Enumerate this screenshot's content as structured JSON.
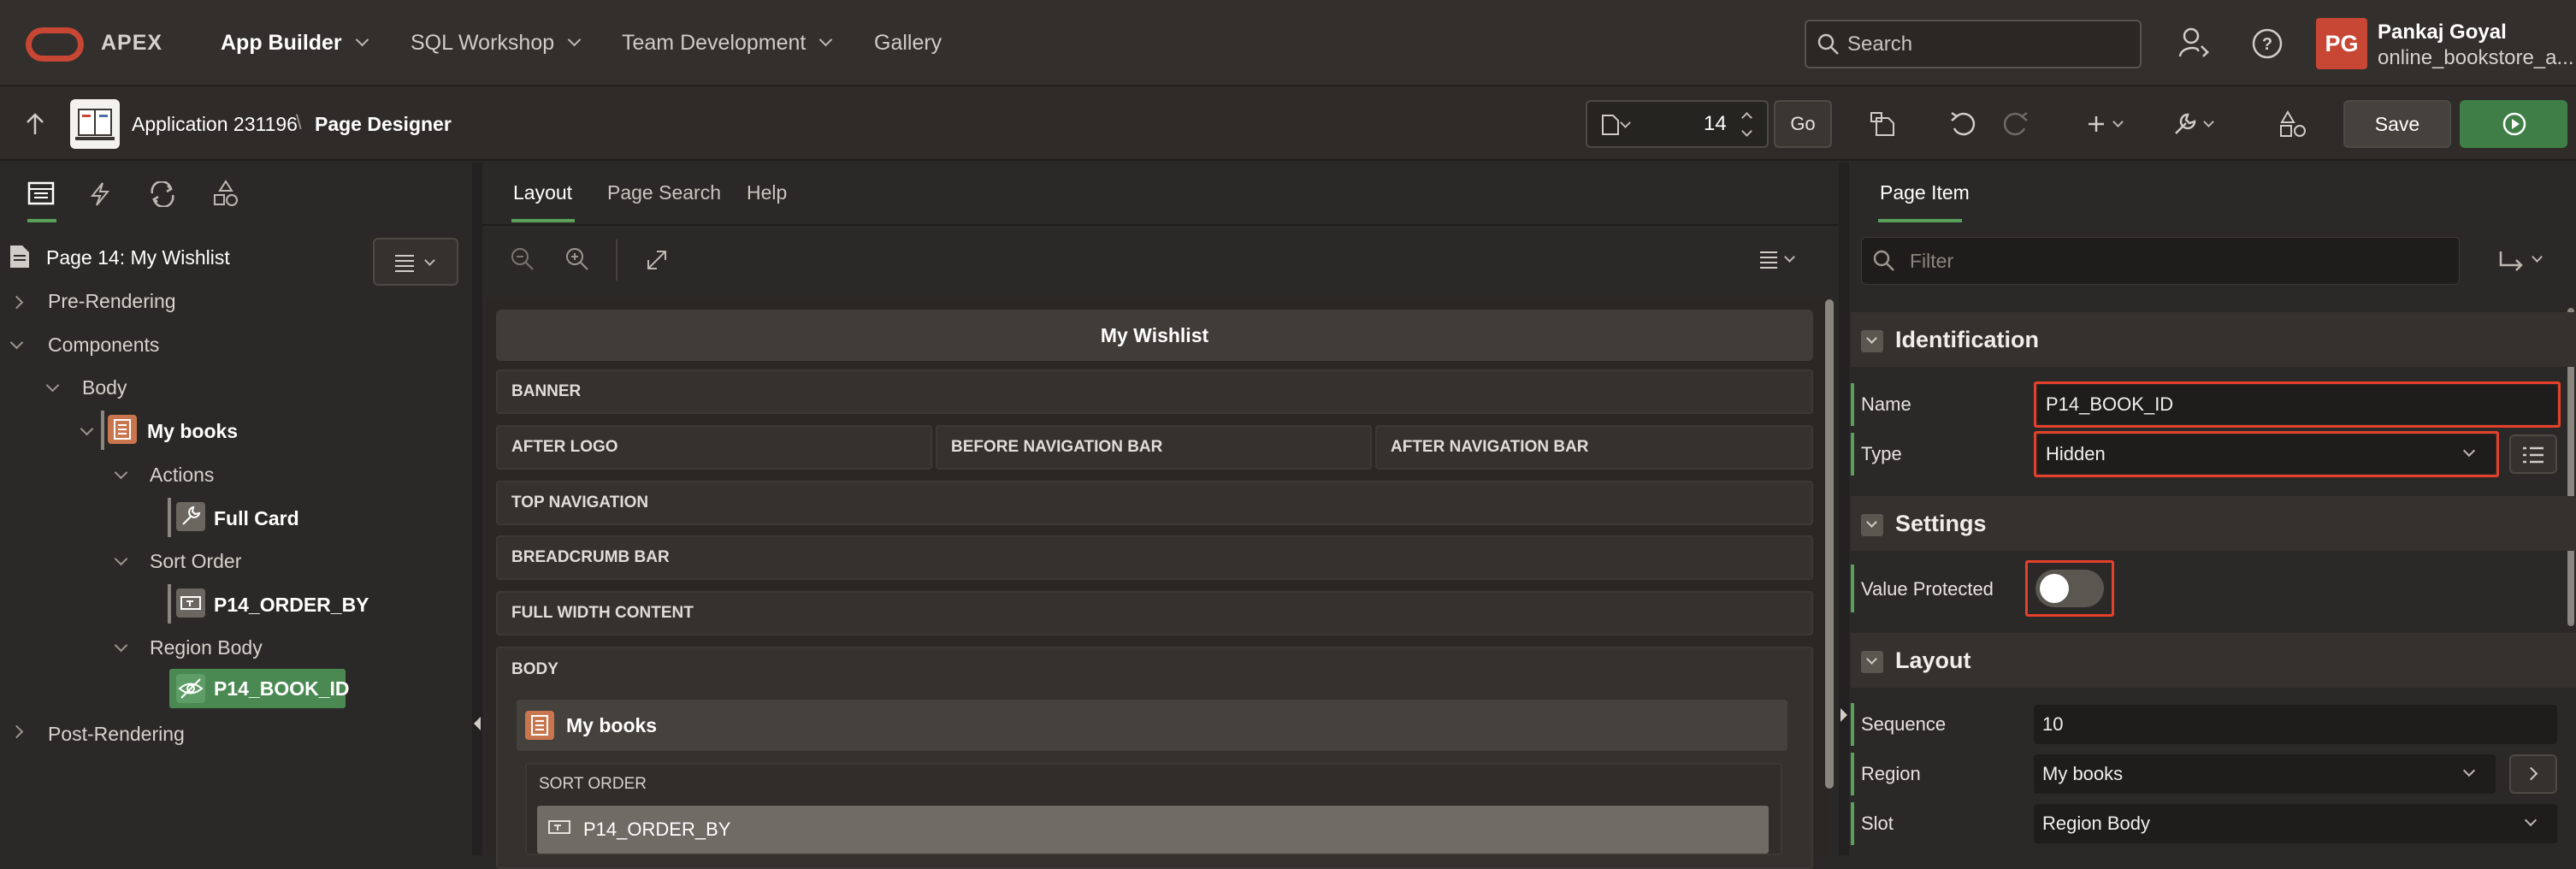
{
  "header": {
    "brand": "APEX",
    "nav": [
      "App Builder",
      "SQL Workshop",
      "Team Development",
      "Gallery"
    ],
    "search_placeholder": "Search",
    "avatar_initials": "PG",
    "user_name": "Pankaj Goyal",
    "workspace": "online_bookstore_a..."
  },
  "toolbar": {
    "application": "Application 231196",
    "separator": "\\",
    "page_designer": "Page Designer",
    "page_number": "14",
    "go_label": "Go",
    "save_label": "Save"
  },
  "left_panel": {
    "page_title": "Page 14: My Wishlist",
    "tree": {
      "pre_rendering": "Pre-Rendering",
      "components": "Components",
      "body": "Body",
      "my_books": "My books",
      "actions": "Actions",
      "full_card": "Full Card",
      "sort_order": "Sort Order",
      "order_by": "P14_ORDER_BY",
      "region_body": "Region Body",
      "book_id": "P14_BOOK_ID",
      "post_rendering": "Post-Rendering"
    }
  },
  "center_panel": {
    "tabs": [
      "Layout",
      "Page Search",
      "Help"
    ],
    "page_header": "My Wishlist",
    "regions": {
      "banner": "BANNER",
      "after_logo": "AFTER LOGO",
      "before_nav": "BEFORE NAVIGATION BAR",
      "after_nav": "AFTER NAVIGATION BAR",
      "top_nav": "TOP NAVIGATION",
      "breadcrumb": "BREADCRUMB BAR",
      "full_width": "FULL WIDTH CONTENT",
      "body": "BODY",
      "my_books": "My books",
      "sort_order": "SORT ORDER",
      "order_by": "P14_ORDER_BY"
    }
  },
  "right_panel": {
    "tab": "Page Item",
    "filter_placeholder": "Filter",
    "identification": {
      "title": "Identification",
      "name_label": "Name",
      "name_value": "P14_BOOK_ID",
      "type_label": "Type",
      "type_value": "Hidden"
    },
    "settings": {
      "title": "Settings",
      "value_protected_label": "Value Protected",
      "value_protected": false
    },
    "layout": {
      "title": "Layout",
      "sequence_label": "Sequence",
      "sequence_value": "10",
      "region_label": "Region",
      "region_value": "My books",
      "slot_label": "Slot",
      "slot_value": "Region Body"
    }
  },
  "colors": {
    "oracle_red": "#c74634",
    "accent_green": "#5aa05a",
    "run_green": "#3f7f47",
    "highlight_red": "#e5402b"
  }
}
